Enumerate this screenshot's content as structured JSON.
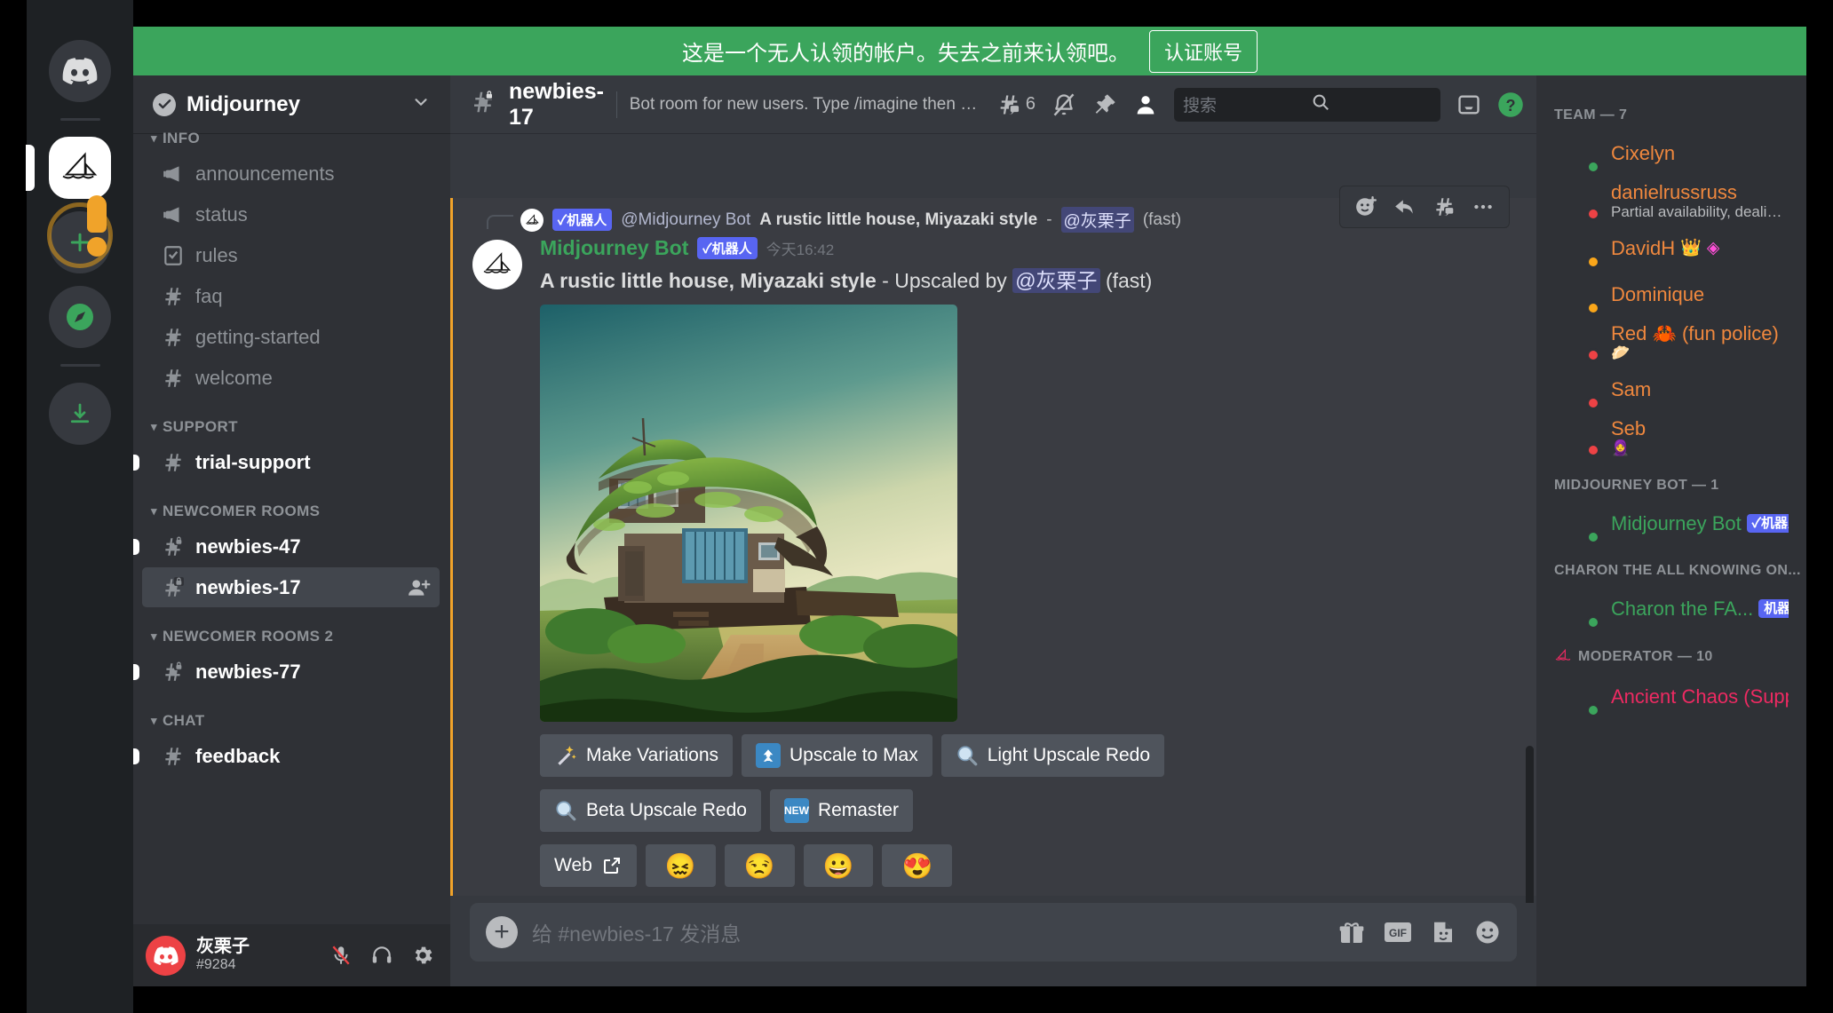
{
  "banner": {
    "text": "这是一个无人认领的帐户。失去之前来认领吧。",
    "button": "认证账号",
    "color": "#3ba55c"
  },
  "rail": {
    "items": [
      {
        "name": "discord-home",
        "icon": "discord-logo"
      },
      {
        "name": "server-midjourney",
        "icon": "sailboat",
        "selected": true
      },
      {
        "name": "add-server",
        "icon": "plus"
      },
      {
        "name": "explore-servers",
        "icon": "compass"
      },
      {
        "name": "download-apps",
        "icon": "download"
      }
    ]
  },
  "sidebar": {
    "server_name": "Midjourney",
    "categories": [
      {
        "label": "INFO",
        "channels": [
          {
            "label": "announcements",
            "icon": "announcement",
            "state": "read"
          },
          {
            "label": "status",
            "icon": "announcement",
            "state": "read"
          },
          {
            "label": "rules",
            "icon": "rules",
            "state": "read"
          },
          {
            "label": "faq",
            "icon": "hash",
            "state": "read"
          },
          {
            "label": "getting-started",
            "icon": "hash",
            "state": "read"
          },
          {
            "label": "welcome",
            "icon": "hash",
            "state": "read"
          }
        ]
      },
      {
        "label": "SUPPORT",
        "channels": [
          {
            "label": "trial-support",
            "icon": "hash",
            "state": "unread"
          }
        ]
      },
      {
        "label": "NEWCOMER ROOMS",
        "channels": [
          {
            "label": "newbies-47",
            "icon": "hash-lock",
            "state": "unread"
          },
          {
            "label": "newbies-17",
            "icon": "hash-lock",
            "state": "active"
          }
        ]
      },
      {
        "label": "NEWCOMER ROOMS 2",
        "channels": [
          {
            "label": "newbies-77",
            "icon": "hash-lock",
            "state": "unread"
          }
        ]
      },
      {
        "label": "CHAT",
        "channels": [
          {
            "label": "feedback",
            "icon": "hash",
            "state": "unread"
          }
        ]
      }
    ]
  },
  "user_bar": {
    "name": "灰栗子",
    "tag": "#9284",
    "icons": [
      "mic-muted-icon",
      "headphones-icon",
      "gear-icon"
    ]
  },
  "channel_header": {
    "name": "newbies-17",
    "topic": "Bot room for new users. Type /imagine then describe what yo...",
    "thread_count": "6",
    "icons": [
      "threads-icon",
      "bell-off-icon",
      "pin-icon",
      "members-icon",
      "inbox-icon",
      "help-icon"
    ]
  },
  "search": {
    "placeholder": "搜索"
  },
  "message": {
    "reply_ref": {
      "bot_badge": "✓机器人",
      "author": "@Midjourney Bot",
      "bold_text": "A rustic little house, Miyazaki style",
      "dash": "-",
      "mention": "@灰栗子",
      "suffix": "(fast)"
    },
    "author": "Midjourney Bot",
    "bot_badge": "✓机器人",
    "timestamp": "今天16:42",
    "text_bold": "A rustic little house, Miyazaki style",
    "text_mid": "- Upscaled by",
    "text_mention": "@灰栗子",
    "text_suffix": "(fast)",
    "image_alt": "A rustic little house, Miyazaki style",
    "buttons_row1": [
      {
        "label": "Make Variations",
        "icon": "magic-wand"
      },
      {
        "label": "Upscale to Max",
        "icon": "upscale-blue"
      },
      {
        "label": "Light Upscale Redo",
        "icon": "magnifier"
      }
    ],
    "buttons_row2": [
      {
        "label": "Beta Upscale Redo",
        "icon": "magnifier"
      },
      {
        "label": "Remaster",
        "icon": "new-badge"
      }
    ],
    "buttons_row3": [
      {
        "label": "Web",
        "icon": "external-link"
      },
      {
        "label": "😖",
        "icon": "emoji"
      },
      {
        "label": "😒",
        "icon": "emoji"
      },
      {
        "label": "😀",
        "icon": "emoji"
      },
      {
        "label": "😍",
        "icon": "emoji"
      }
    ],
    "hover_tools": [
      "add-reaction-icon",
      "reply-icon",
      "create-thread-icon",
      "more-icon"
    ]
  },
  "composer": {
    "placeholder": "给 #newbies-17 发消息",
    "icons": [
      "gift-icon",
      "gif-icon",
      "sticker-icon",
      "emoji-icon"
    ]
  },
  "members": {
    "groups": [
      {
        "label": "TEAM — 7",
        "icon": null,
        "people": [
          {
            "name": "Cixelyn",
            "color": "#f0883e",
            "presence": "on",
            "avatar": "#8bc34a",
            "status": null,
            "badges": []
          },
          {
            "name": "danielrussruss",
            "color": "#f0883e",
            "presence": "dnd",
            "avatar": "#6d7b8d",
            "status": "Partial availability, dealing with...",
            "badges": []
          },
          {
            "name": "DavidH",
            "color": "#f0883e",
            "presence": "idle",
            "avatar": "#1f6fb5",
            "status": null,
            "badges": [
              "👑",
              "◈"
            ]
          },
          {
            "name": "Dominique",
            "color": "#f0883e",
            "presence": "idle",
            "avatar": "#12564f",
            "status": null,
            "badges": []
          },
          {
            "name": "Red 🦀 (fun police)",
            "color": "#f0883e",
            "presence": "dnd",
            "avatar": "#9b59b6",
            "status": "🥟",
            "badges": []
          },
          {
            "name": "Sam",
            "color": "#f0883e",
            "presence": "dnd",
            "avatar": "#3a7ca5",
            "status": null,
            "badges": []
          },
          {
            "name": "Seb",
            "color": "#f0883e",
            "presence": "dnd",
            "avatar": "#c9b59b",
            "status": "🧕",
            "badges": []
          }
        ]
      },
      {
        "label": "MIDJOURNEY BOT — 1",
        "icon": null,
        "people": [
          {
            "name": "Midjourney Bot",
            "color": "#3ba55c",
            "presence": "on",
            "avatar": "#ffffff",
            "status": null,
            "badges": [],
            "bot_badge": "✓机器人"
          }
        ]
      },
      {
        "label": "CHARON THE ALL KNOWING ON...",
        "icon": null,
        "people": [
          {
            "name": "Charon the FA...",
            "color": "#3ba55c",
            "presence": "on",
            "avatar": "#2b4149",
            "status": null,
            "badges": [],
            "bot_badge": "机器人"
          }
        ]
      },
      {
        "label": "MODERATOR — 10",
        "icon": "sailboat-pink",
        "people": [
          {
            "name": "Ancient Chaos (Suppo...",
            "color": "#ed2a62",
            "presence": "on",
            "avatar": "#b03030",
            "status": null,
            "badges": []
          }
        ]
      }
    ]
  }
}
